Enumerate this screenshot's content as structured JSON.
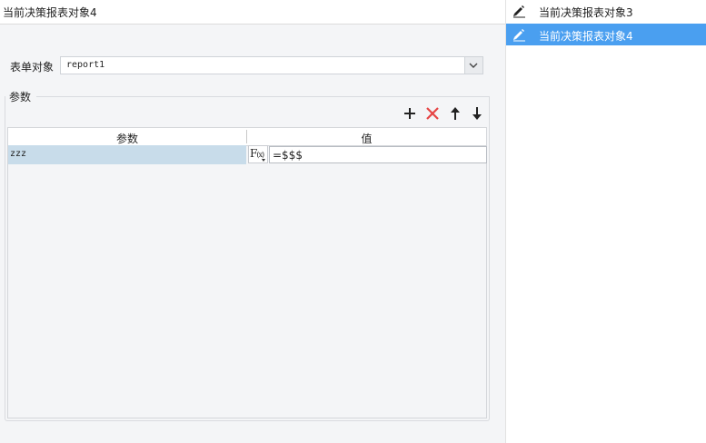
{
  "header": {
    "title": "当前决策报表对象4"
  },
  "form": {
    "report_label": "表单对象",
    "report_value": "report1"
  },
  "params_group": {
    "title": "参数",
    "columns": [
      "参数",
      "值"
    ],
    "rows": [
      {
        "name": "zzz",
        "formula_icon": "F(x)",
        "value": "=$$$"
      }
    ]
  },
  "toolbar": {
    "icons": [
      "add-icon",
      "delete-icon",
      "move-up-icon",
      "move-down-icon"
    ]
  },
  "list": {
    "items": [
      {
        "label": "当前决策报表对象3",
        "selected": false
      },
      {
        "label": "当前决策报表对象4",
        "selected": true
      }
    ]
  },
  "colors": {
    "selected_item": "#4a9ff0",
    "selected_row": "#c8dcea",
    "delete_icon": "#e64545"
  }
}
